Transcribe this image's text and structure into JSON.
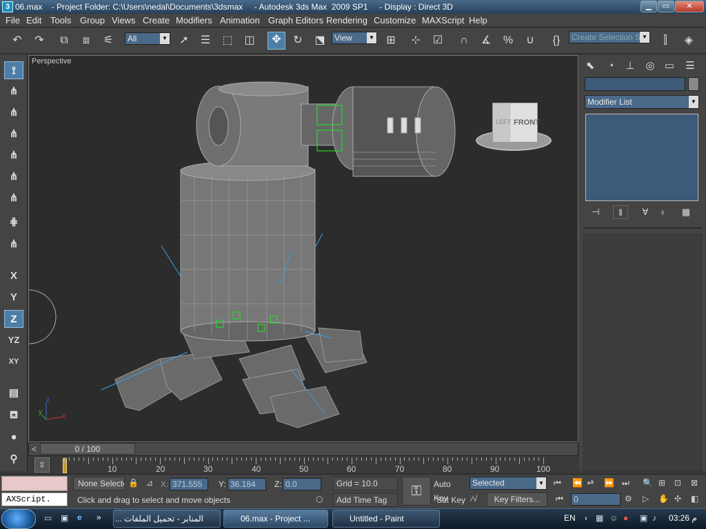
{
  "window": {
    "title": "06.max    - Project Folder: C:\\Users\\nedal\\Documents\\3dsmax     - Autodesk 3ds Max  2009 SP1     - Display : Direct 3D",
    "app_icon": "3",
    "min_btn": "▁",
    "max_btn": "▭",
    "close_btn": "✕"
  },
  "menu": [
    "File",
    "Edit",
    "Tools",
    "Group",
    "Views",
    "Create",
    "Modifiers",
    "Animation",
    "Graph Editors",
    "Rendering",
    "Customize",
    "MAXScript",
    "Help"
  ],
  "toolbar": {
    "filter_value": "All",
    "coord_value": "View",
    "selection_set_placeholder": "Create Selection Set"
  },
  "viewport": {
    "label": "Perspective",
    "viewcube_left": "LEFT",
    "viewcube_front": "FRONT",
    "axis_y": "y",
    "axis_x": "x",
    "axis_z": "z"
  },
  "left_tools": [
    "X",
    "Y",
    "Z",
    "YZ",
    "XY"
  ],
  "right_panel": {
    "modifier_list": "Modifier List"
  },
  "time_slider": {
    "label": "0 / 100",
    "prev": "<",
    "next": ">"
  },
  "ruler": {
    "labels": [
      "10",
      "20",
      "30",
      "40",
      "50",
      "60",
      "70",
      "80",
      "90",
      "100"
    ]
  },
  "status": {
    "selection": "None Selecte",
    "x_label": "X:",
    "x_value": "371.555",
    "y_label": "Y:",
    "y_value": "36.184",
    "z_label": "Z:",
    "z_value": "0.0",
    "grid": "Grid = 10.0",
    "prompt": "Click and drag to select and move objects",
    "add_time_tag": "Add Time Tag",
    "maxscript": "AXScript.",
    "auto_key": "Auto Key",
    "set_key": "Set Key",
    "selected": "Selected",
    "key_filters": "Key Filters...",
    "frame": "0"
  },
  "taskbar": {
    "tasks": [
      {
        "label": "المنابر - تحميل الملفات ..."
      },
      {
        "label": "06.max     - Project ..."
      },
      {
        "label": "Untitled - Paint"
      }
    ],
    "lang": "EN",
    "time": "03:26 م",
    "chevron": "»"
  },
  "colors": {
    "accent": "#4d7ea8",
    "viewport_bg": "#2c2c2c",
    "selection_green": "#22dd22",
    "gizmo_blue": "#3aa0e0"
  }
}
